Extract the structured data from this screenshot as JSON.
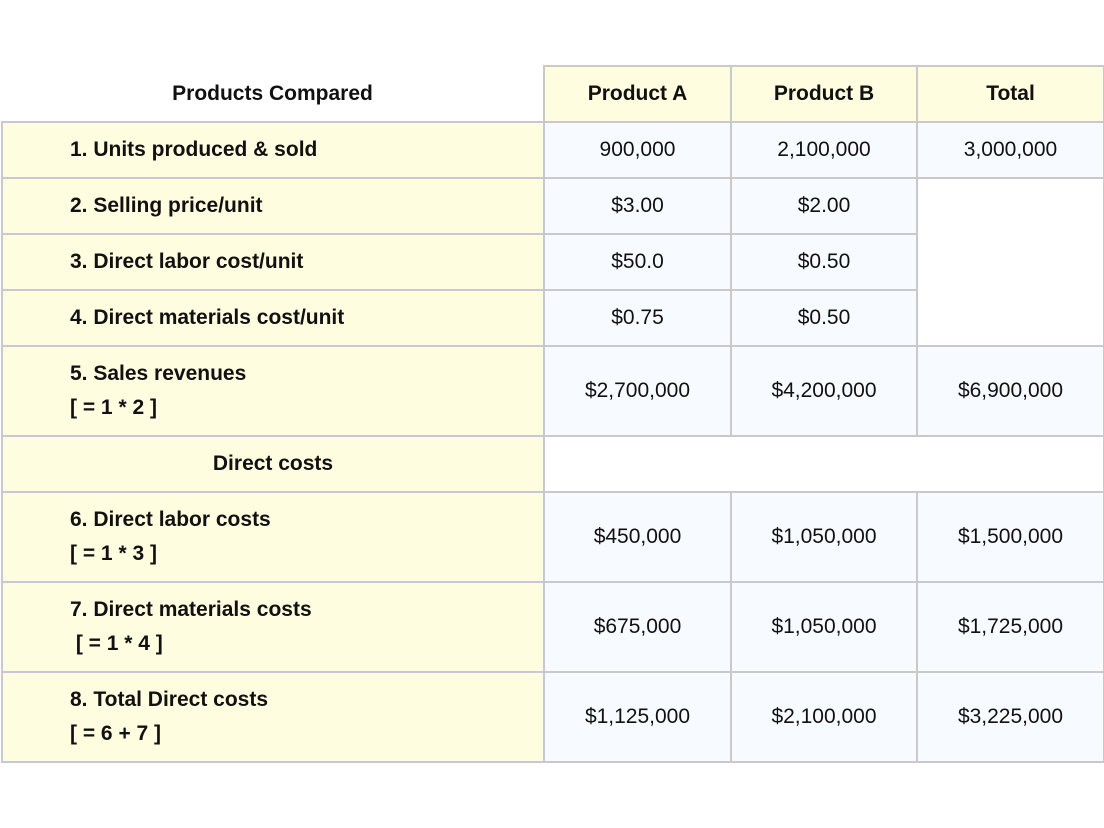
{
  "table": {
    "corner_label": "Products Compared",
    "columns": [
      "Product A",
      "Product B",
      "Total"
    ],
    "rows": [
      {
        "label": "1. Units produced & sold",
        "formula": null,
        "values": [
          "900,000",
          "2,100,000",
          "3,000,000"
        ]
      },
      {
        "label": "2. Selling price/unit",
        "formula": null,
        "values": [
          "$3.00",
          "$2.00",
          null
        ]
      },
      {
        "label": "3. Direct labor cost/unit",
        "formula": null,
        "values": [
          "$50.0",
          "$0.50",
          null
        ]
      },
      {
        "label": "4. Direct materials cost/unit",
        "formula": null,
        "values": [
          "$0.75",
          "$0.50",
          null
        ]
      },
      {
        "label": "5. Sales revenues",
        "formula": "[ = 1 * 2 ]",
        "values": [
          "$2,700,000",
          "$4,200,000",
          "$6,900,000"
        ]
      },
      {
        "label": "Direct costs",
        "section_header": true
      },
      {
        "label": "6. Direct labor costs",
        "formula": "[ = 1 * 3 ]",
        "values": [
          "$450,000",
          "$1,050,000",
          "$1,500,000"
        ]
      },
      {
        "label": "7. Direct materials costs",
        "formula": " [ = 1 * 4 ]",
        "values": [
          "$675,000",
          "$1,050,000",
          "$1,725,000"
        ]
      },
      {
        "label": "8. Total Direct costs",
        "formula": "[ = 6 + 7 ]",
        "values": [
          "$1,125,000",
          "$2,100,000",
          "$3,225,000"
        ]
      }
    ]
  },
  "colors": {
    "label_bg": "#fffde0",
    "value_bg": "#f7fafe",
    "border": "#c9c9c9"
  }
}
